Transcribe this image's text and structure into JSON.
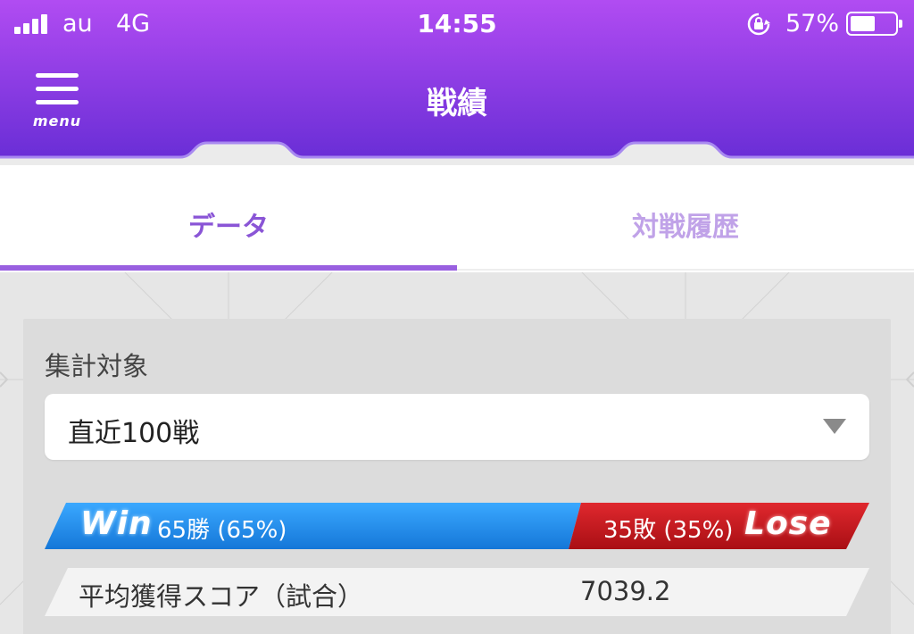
{
  "status_bar": {
    "carrier": "au",
    "network": "4G",
    "time": "14:55",
    "battery_percent": "57%",
    "battery_level": 0.57,
    "icons": [
      "signal-icon",
      "rotation-lock-icon",
      "battery-icon"
    ]
  },
  "header": {
    "menu_label": "menu",
    "title": "戦績",
    "colors": {
      "top": "#b04ef0",
      "bottom": "#6f30d8"
    }
  },
  "tabs": [
    {
      "label": "データ",
      "active": true
    },
    {
      "label": "対戦履歴",
      "active": false
    }
  ],
  "filter": {
    "label": "集計対象",
    "selected": "直近100戦"
  },
  "record": {
    "win_word": "Win",
    "win_text": "65勝 (65%)",
    "win_fraction": 0.65,
    "lose_text": "35敗 (35%)",
    "lose_word": "Lose",
    "colors": {
      "win": "#1e8fe8",
      "lose": "#c8161c"
    }
  },
  "stats": [
    {
      "label": "平均獲得スコア（試合）",
      "value": "7039.2"
    }
  ]
}
